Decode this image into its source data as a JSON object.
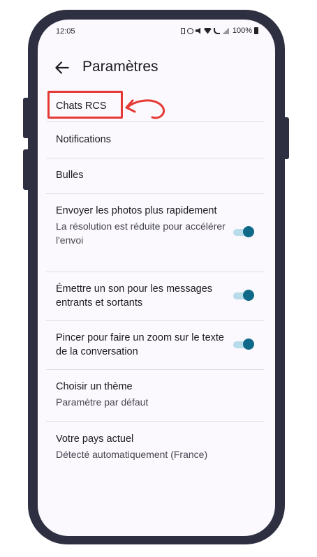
{
  "status_bar": {
    "time": "12:05",
    "battery_text": "100%",
    "icons": [
      "battery-saver-icon",
      "alarm-icon",
      "mute-icon",
      "wifi-icon",
      "wifi-call-icon",
      "signal-icon",
      "battery-icon"
    ]
  },
  "header": {
    "title": "Paramètres",
    "back_icon": "arrow-left-icon"
  },
  "annotation": {
    "highlight_color": "#e53935",
    "arrow_icon": "curved-arrow-left-icon"
  },
  "settings": {
    "chats_rcs": {
      "title": "Chats RCS"
    },
    "notifications": {
      "title": "Notifications"
    },
    "bubbles": {
      "title": "Bulles"
    },
    "send_photos": {
      "title": "Envoyer les photos plus rapidement",
      "subtitle": "La résolution est réduite pour accélérer l'envoi",
      "enabled": true
    },
    "sounds": {
      "title": "Émettre un son pour les messages entrants et sortants",
      "enabled": true
    },
    "pinch_zoom": {
      "title": "Pincer pour faire un zoom sur le texte de la conversation",
      "enabled": true
    },
    "theme": {
      "title": "Choisir un thème",
      "subtitle": "Paramètre par défaut"
    },
    "country": {
      "title": "Votre pays actuel",
      "subtitle": "Détecté automatiquement (France)"
    }
  },
  "colors": {
    "toggle_thumb": "#0e6a88",
    "toggle_track": "#b8dcea",
    "screen_bg": "#fbf8fe",
    "phone_frame": "#2e3042"
  }
}
